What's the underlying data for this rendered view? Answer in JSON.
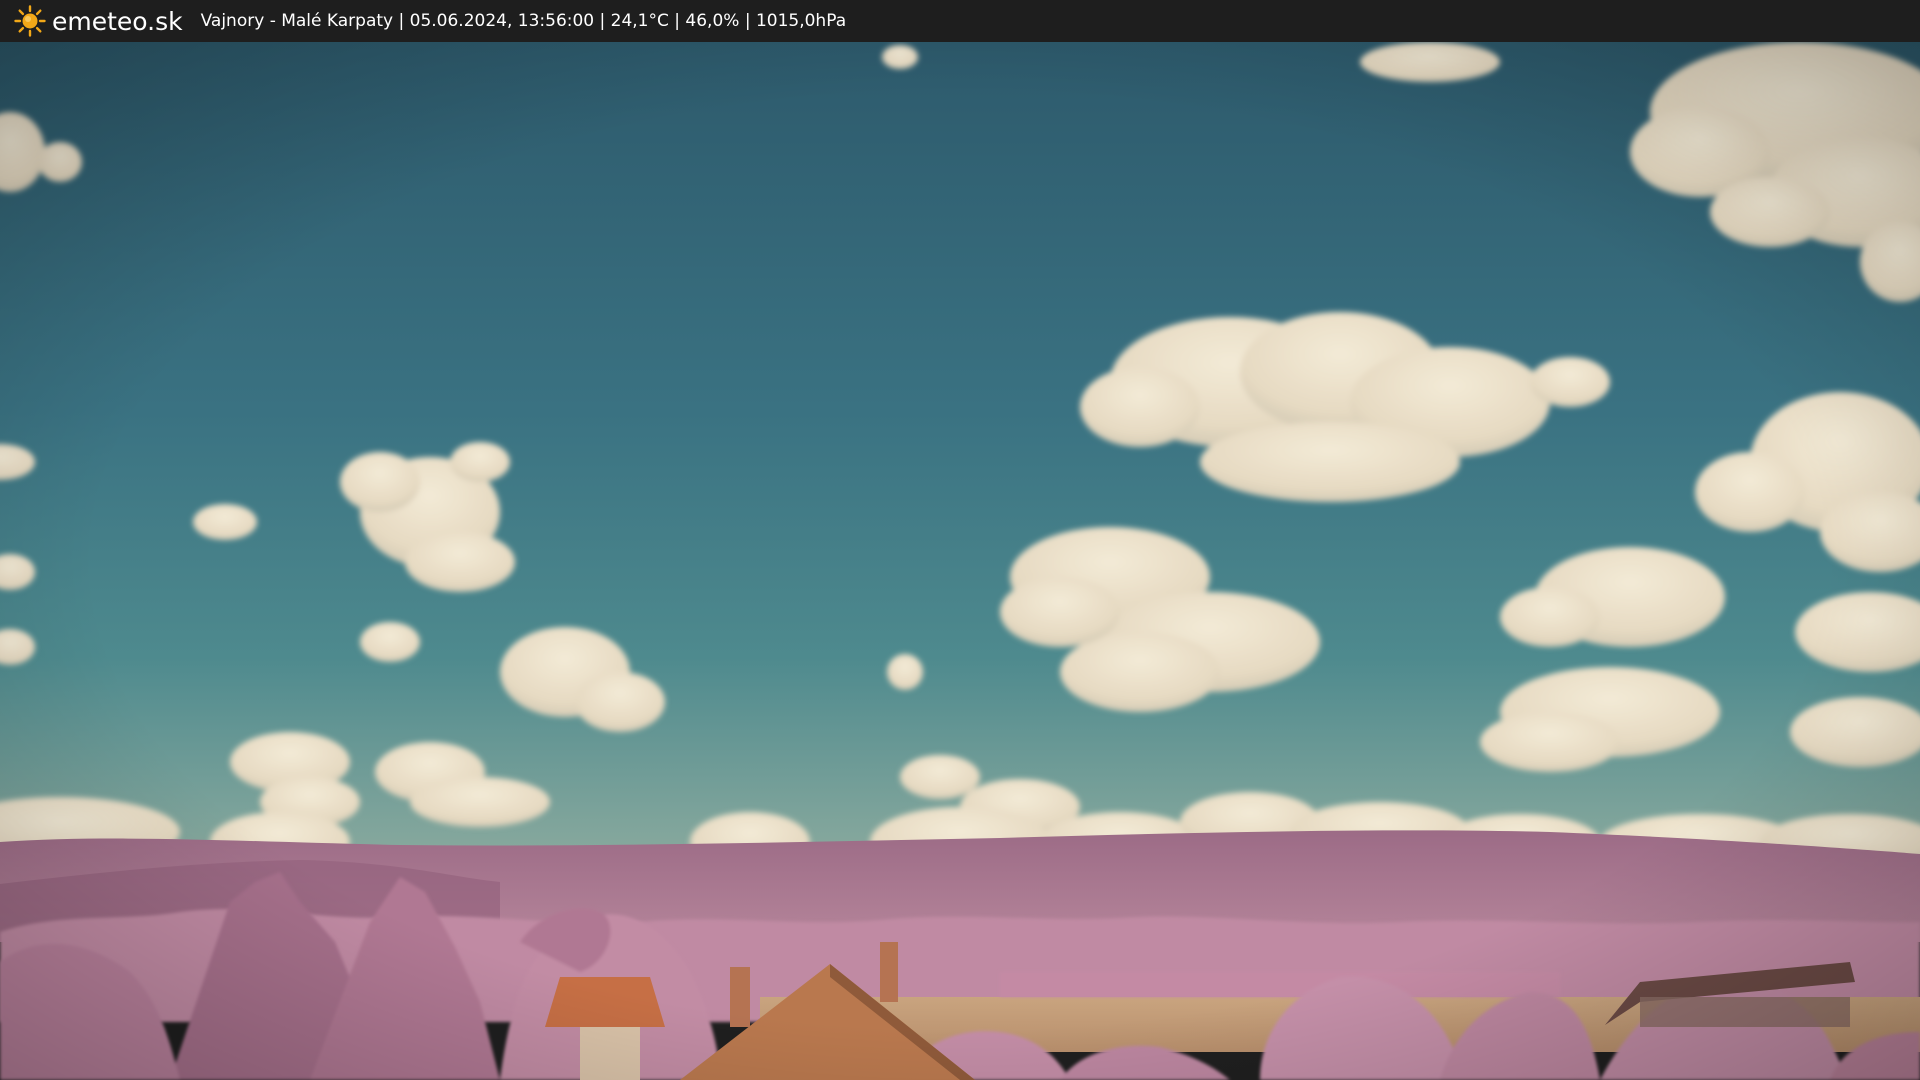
{
  "header": {
    "brand": "emeteo.sk",
    "caption": "Vajnory - Malé Karpaty | 05.06.2024, 13:56:00 | 24,1°C | 46,0% | 1015,0hPa",
    "logo_icon": "sun-icon"
  },
  "colors": {
    "bar": "#1e1e1e",
    "sun": "#f2a818",
    "sky_top": "#2f5e6e",
    "sky_bottom": "#4f8a8e",
    "cloud": "#e9dfca",
    "hills": "#a8768f",
    "trees": "#b97a98",
    "field": "#c8a27e",
    "roof": "#c9774d"
  }
}
